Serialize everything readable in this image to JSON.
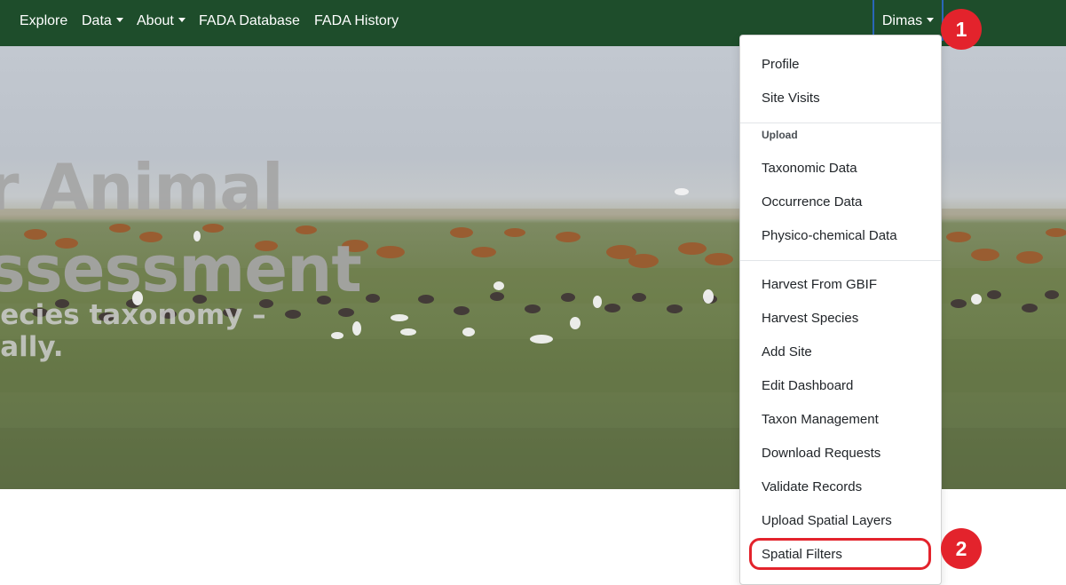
{
  "navbar": {
    "items": [
      {
        "label": "Explore",
        "has_caret": false
      },
      {
        "label": "Data",
        "has_caret": true
      },
      {
        "label": "About",
        "has_caret": true
      },
      {
        "label": "FADA Database",
        "has_caret": false
      },
      {
        "label": "FADA History",
        "has_caret": false
      }
    ],
    "user_label": "Dimas",
    "background_color": "#1e4d2b"
  },
  "hero": {
    "title_line1": "r Animal",
    "title_line2": "ssessment",
    "subtitle_line1": "pecies taxonomy –",
    "subtitle_line2": "bally."
  },
  "user_menu": {
    "items_top": [
      "Profile",
      "Site Visits"
    ],
    "upload_header": "Upload",
    "upload_items": [
      "Taxonomic Data",
      "Occurrence Data",
      "Physico-chemical Data"
    ],
    "admin_items": [
      "Harvest From GBIF",
      "Harvest Species",
      "Add Site",
      "Edit Dashboard",
      "Taxon Management",
      "Download Requests",
      "Validate Records",
      "Upload Spatial Layers",
      "Spatial Filters"
    ]
  },
  "annotations": {
    "step1": "1",
    "step2": "2",
    "color": "#e3232c"
  }
}
